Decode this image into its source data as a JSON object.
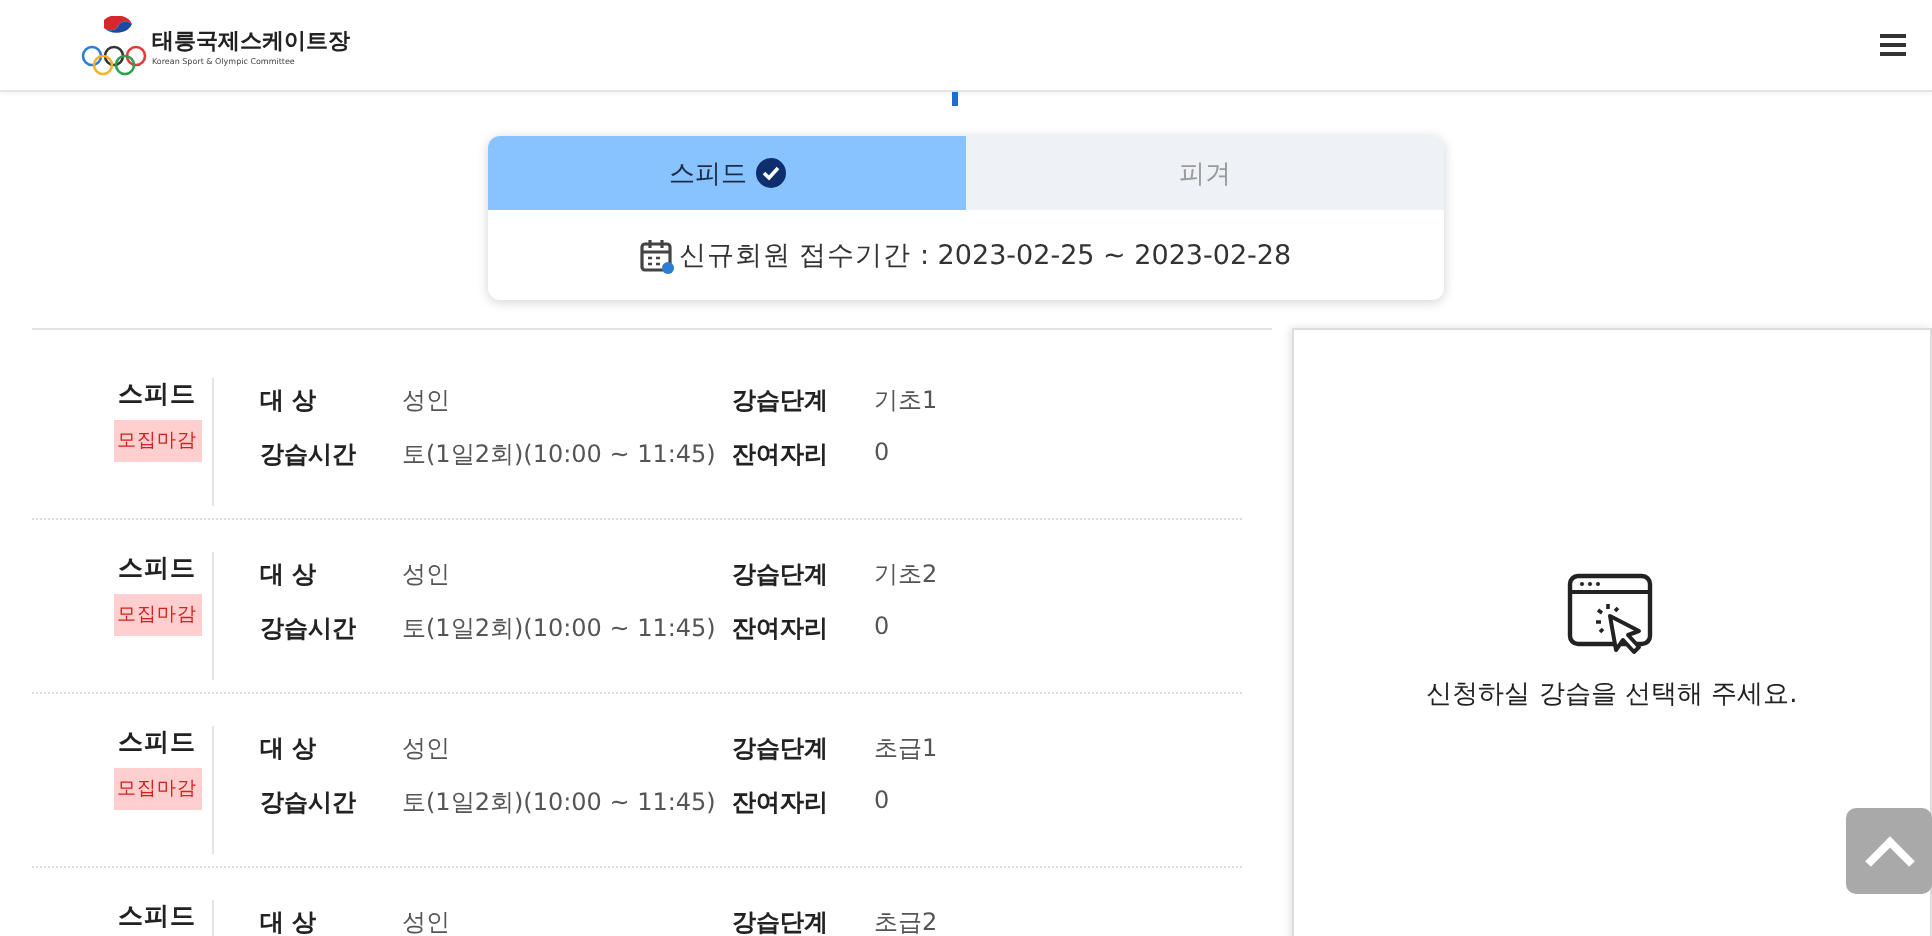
{
  "header": {
    "logo_title": "태릉국제스케이트장",
    "logo_subtitle": "Korean Sport & Olympic Committee"
  },
  "tabs": [
    {
      "label": "스피드",
      "selected": true
    },
    {
      "label": "피겨",
      "selected": false
    }
  ],
  "period": "신규회원 접수기간 : 2023-02-25 ~ 2023-02-28",
  "lessons": [
    {
      "sport": "스피드",
      "badge": "모집마감",
      "fields": [
        {
          "label": "대 상",
          "value": "성인"
        },
        {
          "label": "강습단계",
          "value": "기초1"
        },
        {
          "label": "강습시간",
          "value": "토(1일2회)(10:00 ~ 11:45)"
        },
        {
          "label": "잔여자리",
          "value": "0"
        }
      ]
    },
    {
      "sport": "스피드",
      "badge": "모집마감",
      "fields": [
        {
          "label": "대 상",
          "value": "성인"
        },
        {
          "label": "강습단계",
          "value": "기초2"
        },
        {
          "label": "강습시간",
          "value": "토(1일2회)(10:00 ~ 11:45)"
        },
        {
          "label": "잔여자리",
          "value": "0"
        }
      ]
    },
    {
      "sport": "스피드",
      "badge": "모집마감",
      "fields": [
        {
          "label": "대 상",
          "value": "성인"
        },
        {
          "label": "강습단계",
          "value": "초급1"
        },
        {
          "label": "강습시간",
          "value": "토(1일2회)(10:00 ~ 11:45)"
        },
        {
          "label": "잔여자리",
          "value": "0"
        }
      ]
    },
    {
      "sport": "스피드",
      "fields": [
        {
          "label": "대 상",
          "value": "성인"
        },
        {
          "label": "강습단계",
          "value": "초급2"
        }
      ]
    }
  ],
  "detail_panel": {
    "message": "신청하실 강습을 선택해 주세요."
  }
}
